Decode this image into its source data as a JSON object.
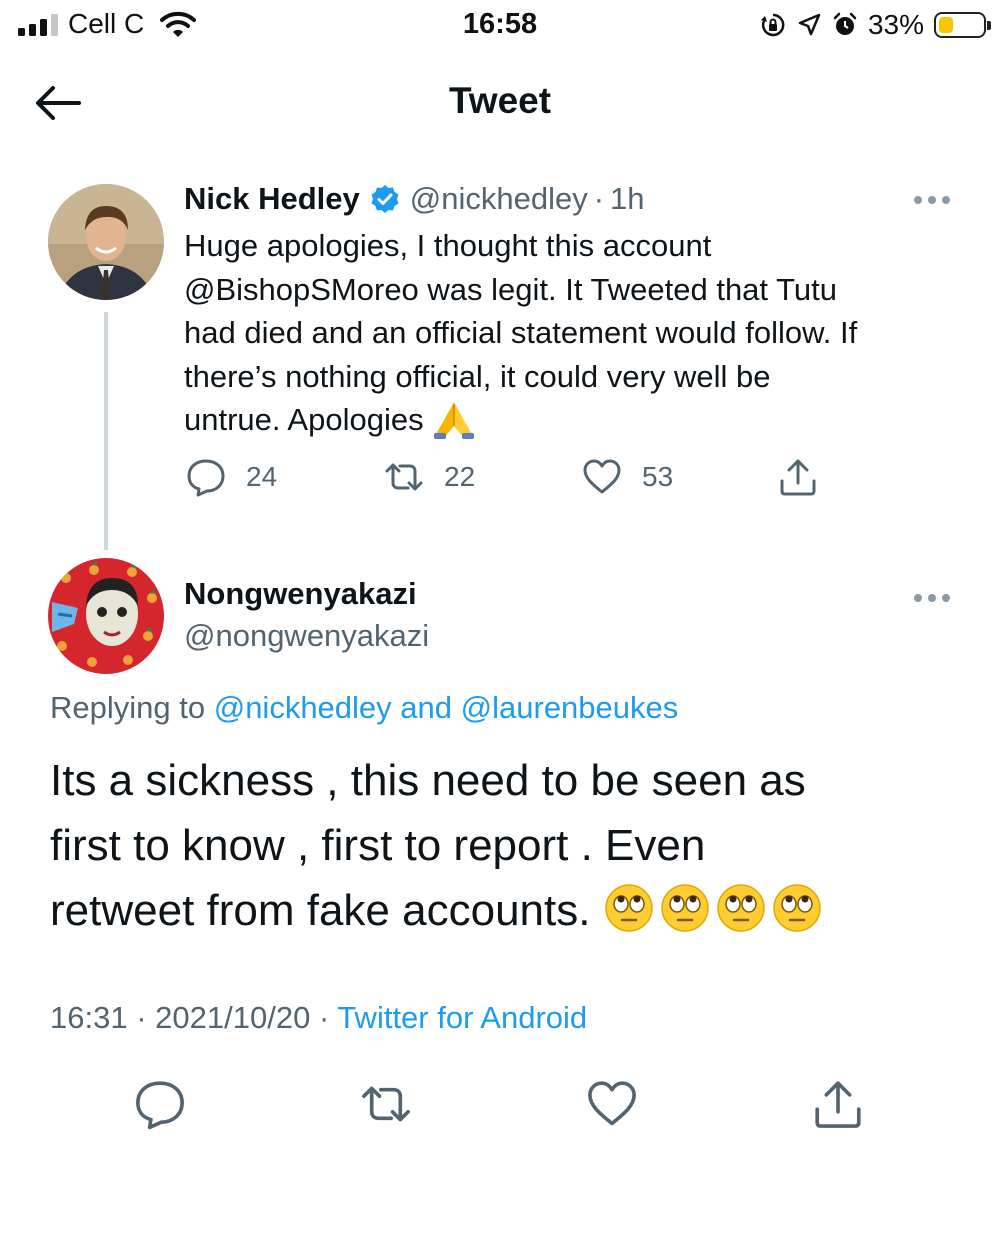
{
  "status_bar": {
    "carrier": "Cell C",
    "time": "16:58",
    "battery_percent": "33%",
    "battery_level": 0.33,
    "icons": [
      "signal-bars-icon",
      "wifi-icon",
      "orientation-lock-icon",
      "location-arrow-icon",
      "alarm-icon",
      "battery-icon"
    ]
  },
  "header": {
    "title": "Tweet",
    "back_icon": "back-arrow-icon"
  },
  "parent_tweet": {
    "name": "Nick Hedley",
    "handle": "@nickhedley",
    "separator": "·",
    "age": "1h",
    "verified": true,
    "text_line1": "Huge apologies, I thought this account",
    "text_line2": "@BishopSMoreo was legit. It  Tweeted that Tutu",
    "text_line3": "had died and an official statement would follow. If",
    "text_line4": "there’s nothing official, it could very well be",
    "text_line5": "untrue. Apologies",
    "emoji": "folded-hands-emoji",
    "replies": "24",
    "retweets": "22",
    "likes": "53"
  },
  "main_tweet": {
    "name": "Nongwenyakazi",
    "handle": "@nongwenyakazi",
    "replying_prefix": "Replying to",
    "replying_user1": "@nickhedley",
    "replying_and": "and",
    "replying_user2": "@laurenbeukes",
    "text_line1": "Its a sickness , this need to be seen as",
    "text_line2": "first to know , first to report . Even",
    "text_line3": "retweet from fake accounts.",
    "emojis": [
      "face-with-rolling-eyes-emoji",
      "face-with-rolling-eyes-emoji",
      "face-with-rolling-eyes-emoji",
      "face-with-rolling-eyes-emoji"
    ],
    "time": "16:31",
    "date": "2021/10/20",
    "separator": "·",
    "source": "Twitter for Android"
  },
  "colors": {
    "accent": "#1d9bf0",
    "muted": "#536471",
    "text": "#0f1419",
    "thread_line": "#cfd9de"
  }
}
